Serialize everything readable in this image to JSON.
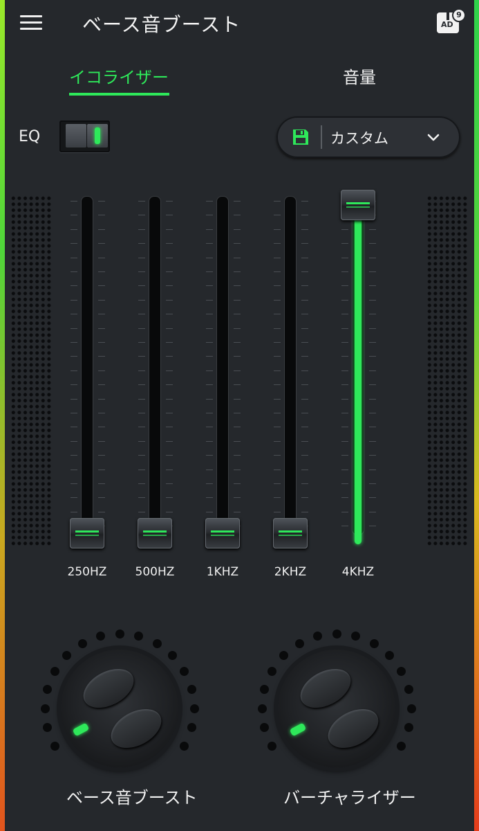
{
  "header": {
    "title": "ベース音ブースト",
    "ad_label": "AD",
    "ad_badge": "9"
  },
  "tabs": [
    {
      "label": "イコライザー",
      "active": true
    },
    {
      "label": "音量",
      "active": false
    }
  ],
  "eq": {
    "label": "EQ",
    "enabled": true
  },
  "preset": {
    "name": "カスタム"
  },
  "bands": [
    {
      "freq": "250HZ",
      "level": 0.0
    },
    {
      "freq": "500HZ",
      "level": 0.0
    },
    {
      "freq": "1KHZ",
      "level": 0.0
    },
    {
      "freq": "2KHZ",
      "level": 0.0
    },
    {
      "freq": "4KHZ",
      "level": 1.0
    }
  ],
  "dials": [
    {
      "label": "ベース音ブースト"
    },
    {
      "label": "バーチャライザー"
    }
  ],
  "colors": {
    "accent": "#2ee85a",
    "background": "#25282c"
  }
}
